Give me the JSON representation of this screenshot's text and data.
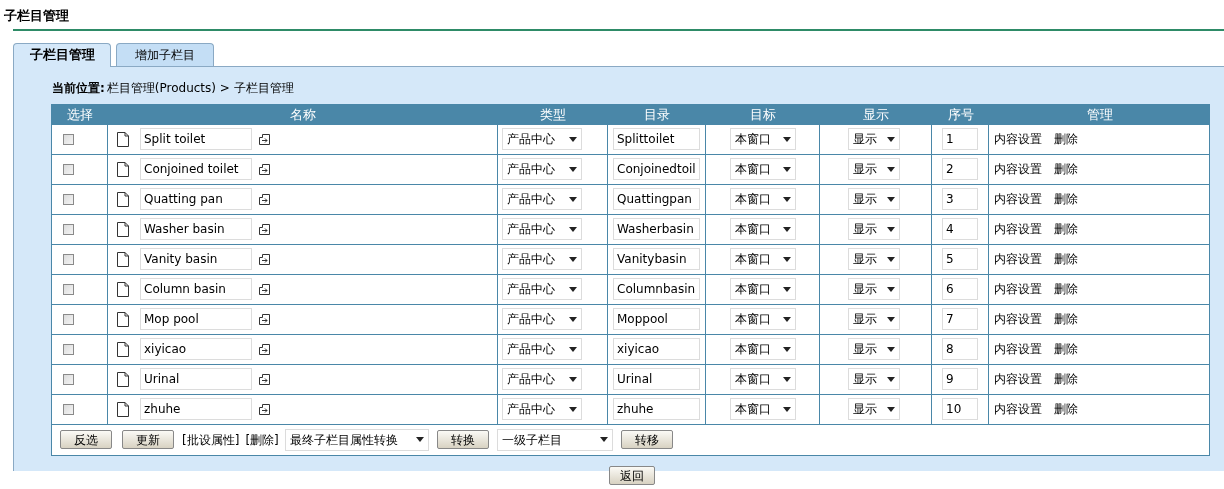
{
  "page_title": "子栏目管理",
  "tabs": [
    {
      "label": "子栏目管理",
      "selected": true
    },
    {
      "label": "增加子栏目",
      "selected": false
    }
  ],
  "breadcrumb": {
    "label": "当前位置:",
    "path": "栏目管理(Products) > 子栏目管理"
  },
  "table": {
    "columns": [
      "选择",
      "名称",
      "类型",
      "目录",
      "目标",
      "显示",
      "序号",
      "管理"
    ],
    "rows": [
      {
        "checked": false,
        "name": "Split toilet",
        "type": "产品中心",
        "directory": "Splittoilet",
        "target": "本窗口",
        "display": "显示",
        "order": "1",
        "actions": [
          "内容设置",
          "删除"
        ]
      },
      {
        "checked": false,
        "name": "Conjoined toilet",
        "type": "产品中心",
        "directory": "Conjoinedtoil",
        "target": "本窗口",
        "display": "显示",
        "order": "2",
        "actions": [
          "内容设置",
          "删除"
        ]
      },
      {
        "checked": false,
        "name": "Quatting pan",
        "type": "产品中心",
        "directory": "Quattingpan",
        "target": "本窗口",
        "display": "显示",
        "order": "3",
        "actions": [
          "内容设置",
          "删除"
        ]
      },
      {
        "checked": false,
        "name": "Washer basin",
        "type": "产品中心",
        "directory": "Washerbasin",
        "target": "本窗口",
        "display": "显示",
        "order": "4",
        "actions": [
          "内容设置",
          "删除"
        ]
      },
      {
        "checked": false,
        "name": "Vanity basin",
        "type": "产品中心",
        "directory": "Vanitybasin",
        "target": "本窗口",
        "display": "显示",
        "order": "5",
        "actions": [
          "内容设置",
          "删除"
        ]
      },
      {
        "checked": false,
        "name": "Column basin",
        "type": "产品中心",
        "directory": "Columnbasin",
        "target": "本窗口",
        "display": "显示",
        "order": "6",
        "actions": [
          "内容设置",
          "删除"
        ]
      },
      {
        "checked": false,
        "name": "Mop pool",
        "type": "产品中心",
        "directory": "Moppool",
        "target": "本窗口",
        "display": "显示",
        "order": "7",
        "actions": [
          "内容设置",
          "删除"
        ]
      },
      {
        "checked": false,
        "name": "xiyicao",
        "type": "产品中心",
        "directory": "xiyicao",
        "target": "本窗口",
        "display": "显示",
        "order": "8",
        "actions": [
          "内容设置",
          "删除"
        ]
      },
      {
        "checked": false,
        "name": "Urinal",
        "type": "产品中心",
        "directory": "Urinal",
        "target": "本窗口",
        "display": "显示",
        "order": "9",
        "actions": [
          "内容设置",
          "删除"
        ]
      },
      {
        "checked": false,
        "name": "zhuhe",
        "type": "产品中心",
        "directory": "zhuhe",
        "target": "本窗口",
        "display": "显示",
        "order": "10",
        "actions": [
          "内容设置",
          "删除"
        ]
      }
    ]
  },
  "footer": [
    {
      "kind": "button",
      "text": "反选"
    },
    {
      "kind": "button",
      "text": "更新"
    },
    {
      "kind": "link",
      "text": "[批设属性]"
    },
    {
      "kind": "link",
      "text": "[删除]"
    },
    {
      "kind": "select",
      "text": "最终子栏目属性转换"
    },
    {
      "kind": "button",
      "text": "转换"
    },
    {
      "kind": "select",
      "text": "一级子栏目"
    },
    {
      "kind": "button",
      "text": "转移"
    }
  ],
  "back_button": "返回"
}
